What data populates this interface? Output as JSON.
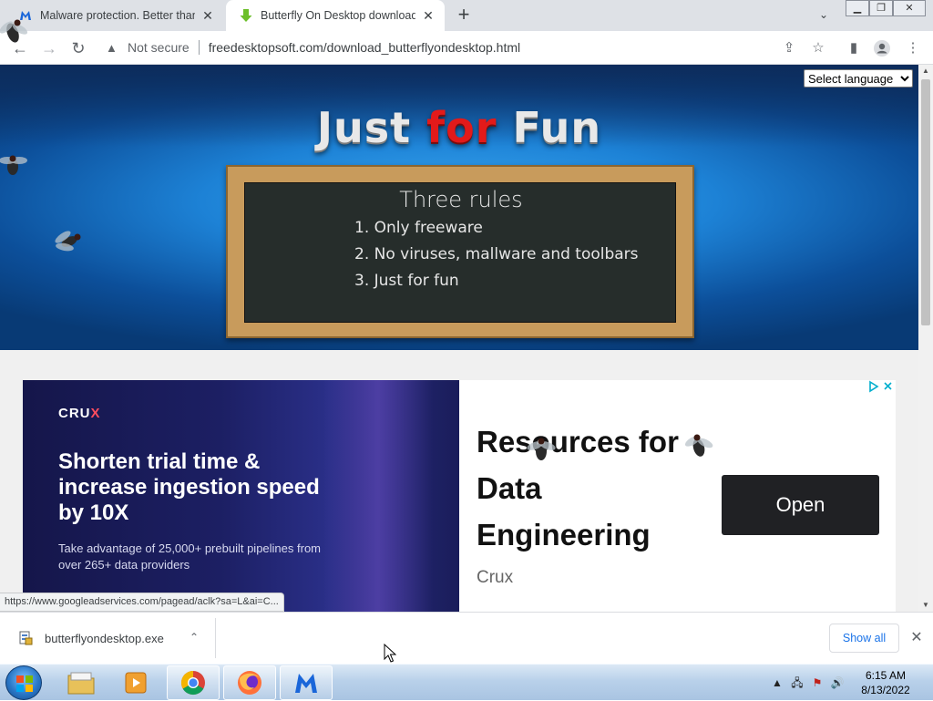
{
  "browser": {
    "tabs": [
      {
        "title": "Malware protection. Better than",
        "active": false
      },
      {
        "title": "Butterfly On Desktop download (",
        "active": true
      }
    ],
    "address_bar": {
      "security_label": "Not secure",
      "url": "freedesktopsoft.com/download_butterflyondesktop.html"
    }
  },
  "page": {
    "language_select": {
      "selected": "Select language"
    },
    "headline": {
      "just": "Just",
      "for": "for",
      "fun": "Fun"
    },
    "board": {
      "title": "Three rules",
      "rules": [
        "1. Only freeware",
        "2. No viruses, mallware and toolbars",
        "3. Just for fun"
      ]
    },
    "ad": {
      "brand": "CRU",
      "brand_x": "X",
      "headline": "Shorten trial time & increase ingestion speed by 10X",
      "subtext": "Take advantage of 25,000+ prebuilt pipelines from over 265+ data providers",
      "title": "Resources for Data Engineering",
      "advertiser": "Crux",
      "cta": "Open"
    },
    "status_url": "https://www.googleadservices.com/pagead/aclk?sa=L&ai=C..."
  },
  "download_bar": {
    "file_name": "butterflyondesktop.exe",
    "show_all": "Show all"
  },
  "taskbar": {
    "time": "6:15 AM",
    "date": "8/13/2022"
  },
  "colors": {
    "headline_accent": "#e21a1a",
    "ad_left_bg": "#1c1f63",
    "cta_bg": "#202124",
    "link_blue": "#1a73e8"
  }
}
